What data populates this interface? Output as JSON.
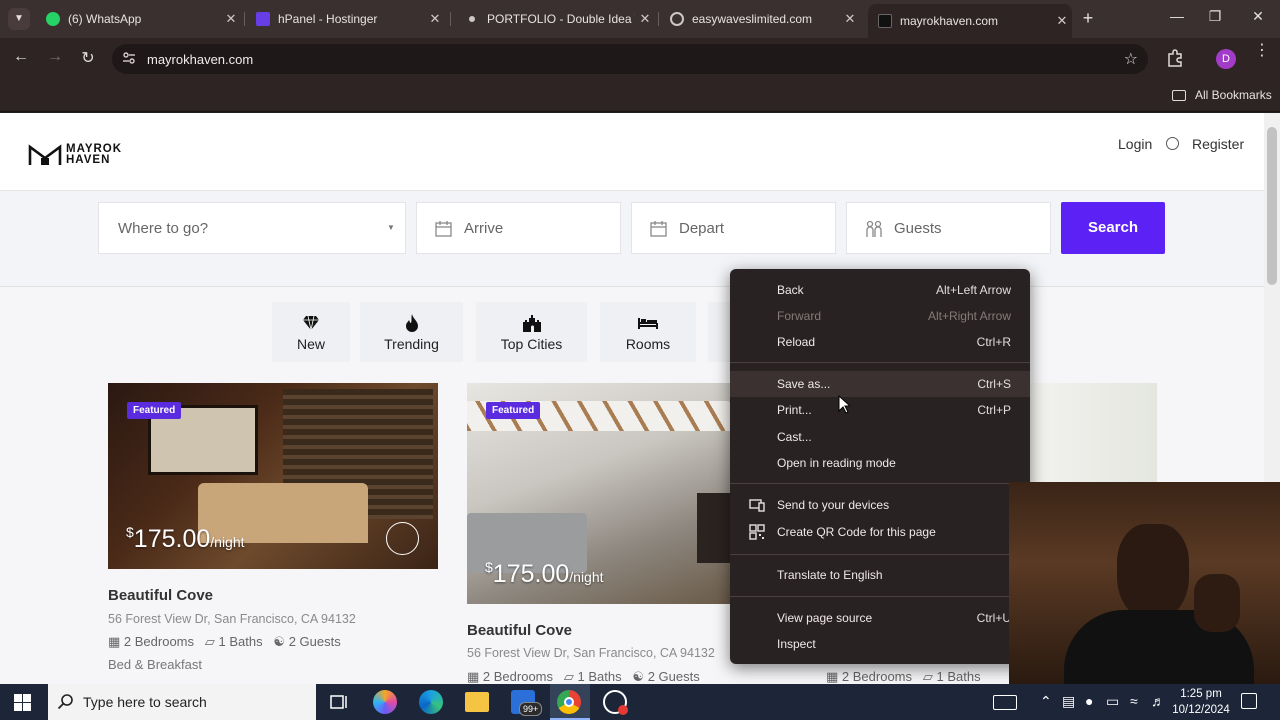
{
  "browser": {
    "tabs": [
      {
        "title": "(6) WhatsApp",
        "favicon": "whatsapp-icon",
        "color": "#25d366"
      },
      {
        "title": "hPanel - Hostinger",
        "favicon": "hostinger-icon",
        "color": "#673de6"
      },
      {
        "title": "PORTFOLIO - Double Idea Te",
        "favicon": "dot-icon",
        "color": "#cfc7c7"
      },
      {
        "title": "easywaveslimited.com",
        "favicon": "globe-icon",
        "color": "#cfc7c7"
      },
      {
        "title": "mayrokhaven.com",
        "favicon": "mayrok-icon",
        "color": "#1a1a1a",
        "active": true
      }
    ],
    "url": "mayrokhaven.com",
    "profile_initial": "D",
    "profile_color": "#a23cc8",
    "bookmarks_label": "All Bookmarks"
  },
  "site": {
    "logo_line1": "MAYROK",
    "logo_line2": "HAVEN",
    "nav": {
      "login": "Login",
      "register": "Register"
    },
    "search": {
      "where": "Where to go?",
      "arrive": "Arrive",
      "depart": "Depart",
      "guests": "Guests",
      "button": "Search",
      "button_color": "#5b21f5"
    },
    "categories": [
      {
        "label": "New",
        "icon": "diamond-icon"
      },
      {
        "label": "Trending",
        "icon": "flame-icon"
      },
      {
        "label": "Top Cities",
        "icon": "castle-icon"
      },
      {
        "label": "Rooms",
        "icon": "bed-icon"
      }
    ],
    "listings": [
      {
        "badge": "Featured",
        "currency": "$",
        "price": "175.00",
        "unit": "/night",
        "title": "Beautiful Cove",
        "address": "56 Forest View Dr, San Francisco, CA 94132",
        "bedrooms": "2 Bedrooms",
        "baths": "1 Baths",
        "guests": "2 Guests",
        "type": "Bed & Breakfast"
      },
      {
        "badge": "Featured",
        "currency": "$",
        "price": "175.00",
        "unit": "/night",
        "title": "Beautiful Cove",
        "address": "56 Forest View Dr, San Francisco, CA 94132",
        "bedrooms": "2 Bedrooms",
        "baths": "1 Baths",
        "guests": "2 Guests"
      },
      {
        "bedrooms": "2 Bedrooms",
        "baths": "1 Baths"
      }
    ]
  },
  "context_menu": {
    "items": [
      {
        "label": "Back",
        "shortcut": "Alt+Left Arrow"
      },
      {
        "label": "Forward",
        "shortcut": "Alt+Right Arrow",
        "disabled": true
      },
      {
        "label": "Reload",
        "shortcut": "Ctrl+R"
      },
      {
        "label": "Save as...",
        "shortcut": "Ctrl+S",
        "hovered": true
      },
      {
        "label": "Print...",
        "shortcut": "Ctrl+P"
      },
      {
        "label": "Cast..."
      },
      {
        "label": "Open in reading mode"
      },
      {
        "label": "Send to your devices",
        "icon": "devices-icon"
      },
      {
        "label": "Create QR Code for this page",
        "icon": "qr-code-icon"
      },
      {
        "label": "Translate to English"
      },
      {
        "label": "View page source",
        "shortcut": "Ctrl+U"
      },
      {
        "label": "Inspect"
      }
    ]
  },
  "taskbar": {
    "search_placeholder": "Type here to search",
    "mail_badge": "99+",
    "time": "1:25 pm",
    "date": "10/12/2024"
  }
}
